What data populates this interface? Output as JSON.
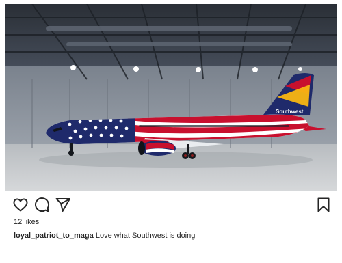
{
  "post": {
    "image": {
      "subject": "Southwest Boeing 737 in American flag livery inside a hangar",
      "livery_text": "Southwest"
    },
    "actions": {
      "like_icon": "heart-icon",
      "comment_icon": "comment-icon",
      "share_icon": "send-icon",
      "save_icon": "bookmark-icon"
    },
    "likes_label": "12 likes",
    "caption": {
      "username": "loyal_patriot_to_maga",
      "text": "Love what Southwest is doing"
    }
  },
  "colors": {
    "navy": "#1f2a6b",
    "red": "#c8102e",
    "gold": "#f9b612",
    "white": "#ffffff",
    "text": "#262626"
  }
}
